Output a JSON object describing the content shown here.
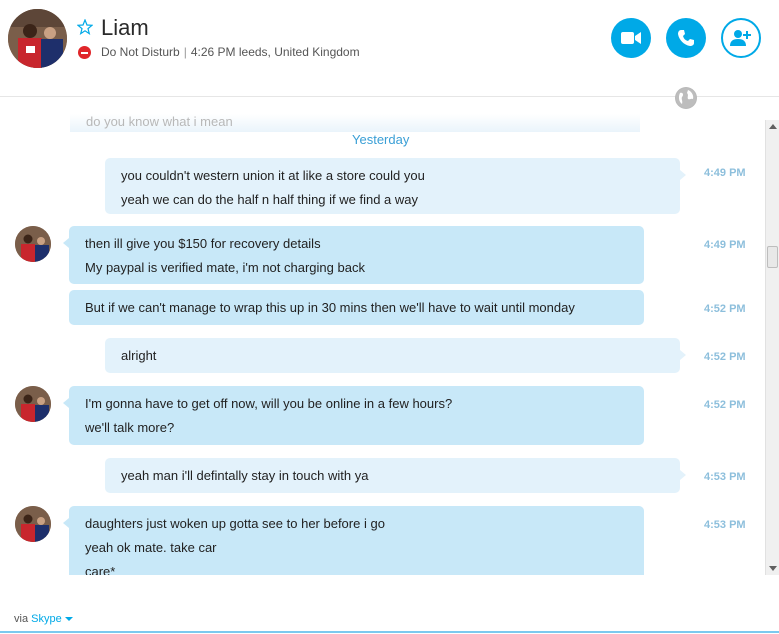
{
  "contact": {
    "name": "Liam",
    "status": "Do Not Disturb",
    "local_time": "4:26 PM leeds, United Kingdom",
    "separator": "|"
  },
  "actions": {
    "video_call": "video-camera-icon",
    "voice_call": "phone-icon",
    "add_people": "add-person-icon"
  },
  "colors": {
    "accent": "#00a9e7",
    "bubble_me": "#e3f2fb",
    "bubble_them": "#c8e8f8",
    "dnd": "#e0262a",
    "time": "#8dbfdc"
  },
  "conversation": {
    "faded_previous": "do you know what i mean",
    "day_separator": "Yesterday",
    "messages": [
      {
        "sender": "me",
        "lines": [
          "you couldn't western union it at like a store could you",
          "yeah we can do the half n half thing if we find a way"
        ],
        "time": "4:49 PM"
      },
      {
        "sender": "them",
        "lines": [
          "then ill give you $150 for recovery details",
          "My paypal is verified mate, i'm not charging back"
        ],
        "time": "4:49 PM"
      },
      {
        "sender": "them",
        "lines": [
          "But if we can't manage to wrap this up in 30 mins then we'll have to wait until monday"
        ],
        "time": "4:52 PM"
      },
      {
        "sender": "me",
        "lines": [
          "alright"
        ],
        "time": "4:52 PM"
      },
      {
        "sender": "them",
        "lines": [
          "I'm gonna have to get off now, will you be online in a few hours?",
          "we'll talk more?"
        ],
        "time": "4:52 PM"
      },
      {
        "sender": "me",
        "lines": [
          "yeah man i'll defintally stay in touch with ya"
        ],
        "time": "4:53 PM"
      },
      {
        "sender": "them",
        "lines": [
          "daughters just woken up gotta see to her before i go",
          "yeah ok mate. take car",
          "care*"
        ],
        "time": "4:53 PM"
      }
    ]
  },
  "footer": {
    "via_label": "via",
    "service": "Skype"
  }
}
